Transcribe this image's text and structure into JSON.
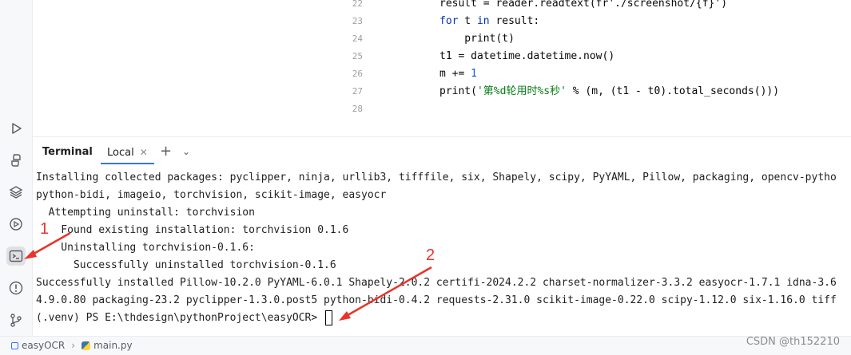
{
  "editor": {
    "lines": [
      {
        "num": "22",
        "text": "result = reader.readtext(fr'./screenshot/{f}')"
      },
      {
        "num": "23",
        "kw": "for",
        "mid1": " t ",
        "kw2": "in",
        "mid2": " result:"
      },
      {
        "num": "24",
        "text": "    print(t)"
      },
      {
        "num": "25",
        "text": "t1 = datetime.datetime.now()"
      },
      {
        "num": "26",
        "pre": "m += ",
        "numval": "1"
      },
      {
        "num": "27",
        "pre": "print(",
        "str": "'第%d轮用时%s秒'",
        "post": " % (m, (t1 - t0).total_seconds()))"
      },
      {
        "num": "28",
        "text": ""
      }
    ]
  },
  "terminal": {
    "title": "Terminal",
    "tab_label": "Local",
    "lines": [
      "Installing collected packages: pyclipper, ninja, urllib3, tifffile, six, Shapely, scipy, PyYAML, Pillow, packaging, opencv-pytho",
      "python-bidi, imageio, torchvision, scikit-image, easyocr",
      "  Attempting uninstall: torchvision",
      "    Found existing installation: torchvision 0.1.6",
      "    Uninstalling torchvision-0.1.6:",
      "      Successfully uninstalled torchvision-0.1.6",
      "Successfully installed Pillow-10.2.0 PyYAML-6.0.1 Shapely-2.0.2 certifi-2024.2.2 charset-normalizer-3.3.2 easyocr-1.7.1 idna-3.6",
      "4.9.0.80 packaging-23.2 pyclipper-1.3.0.post5 python-bidi-0.4.2 requests-2.31.0 scikit-image-0.22.0 scipy-1.12.0 six-1.16.0 tiff"
    ],
    "prompt": "(.venv) PS E:\\thdesign\\pythonProject\\easyOCR>"
  },
  "statusbar": {
    "project": "easyOCR",
    "file": "main.py"
  },
  "watermark": "CSDN @th152210",
  "annotations": {
    "one": "1",
    "two": "2",
    "color": "#e8342a"
  },
  "sidebar_icons": [
    "run-icon",
    "python-console-icon",
    "layers-icon",
    "services-icon",
    "terminal-icon",
    "problems-icon",
    "git-icon"
  ]
}
